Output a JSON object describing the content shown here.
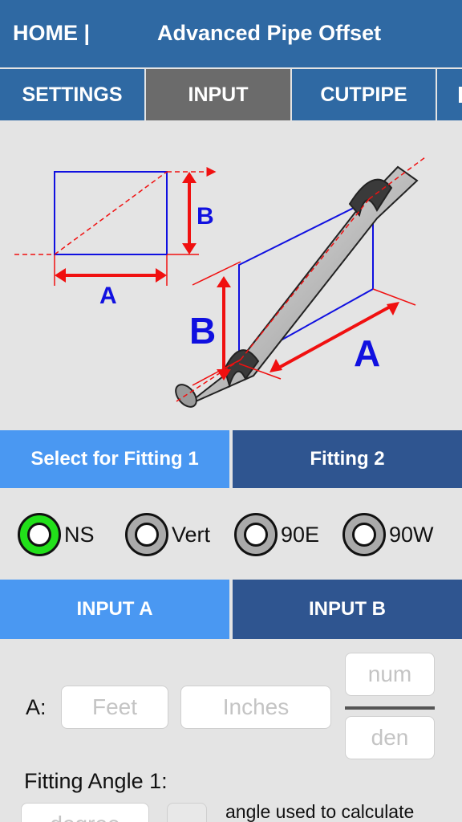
{
  "header": {
    "home": "HOME  |",
    "title": "Advanced Pipe Offset"
  },
  "tabs": [
    {
      "label": "SETTINGS"
    },
    {
      "label": "INPUT"
    },
    {
      "label": "CUTPIPE"
    }
  ],
  "diagram": {
    "label_a": "A",
    "label_b": "B"
  },
  "fitting_buttons": {
    "fitting1": "Select for Fitting 1",
    "fitting2": "Fitting 2"
  },
  "radios": [
    {
      "label": "NS",
      "selected": true
    },
    {
      "label": "Vert",
      "selected": false
    },
    {
      "label": "90E",
      "selected": false
    },
    {
      "label": "90W",
      "selected": false
    }
  ],
  "input_buttons": {
    "a": "INPUT A",
    "b": "INPUT B"
  },
  "form": {
    "a_label": "A:",
    "feet_placeholder": "Feet",
    "inches_placeholder": "Inches",
    "num_placeholder": "num",
    "den_placeholder": "den",
    "angle_label": "Fitting Angle 1:",
    "degree_placeholder": "degree",
    "angle_note": "angle used to calculate"
  },
  "colors": {
    "header_blue": "#2f69a3",
    "active_tab": "#6b6b6b",
    "light_blue": "#4a98f2",
    "dark_blue": "#2f5590",
    "radio_on": "#22e01a",
    "diagram_blue": "#1010e0",
    "diagram_red": "#f01010"
  }
}
